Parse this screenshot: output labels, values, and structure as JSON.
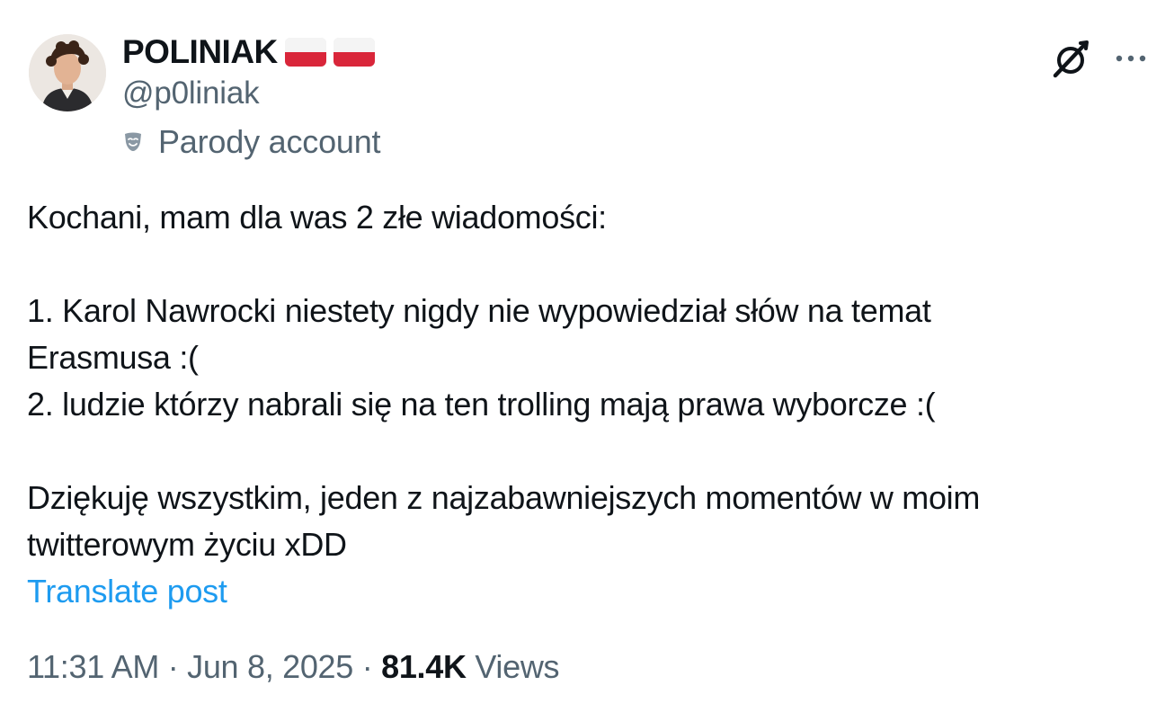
{
  "author": {
    "display_name": "POLINIAK",
    "handle": "@p0liniak",
    "flags": [
      "poland-flag",
      "poland-flag"
    ],
    "label": "Parody account",
    "label_icon": "theater-mask-icon"
  },
  "actions": {
    "grok_icon": "grok-icon",
    "more_icon": "more-dots-icon"
  },
  "post": {
    "lines": [
      "Kochani, mam dla was 2 złe wiadomości:",
      "",
      "1. Karol Nawrocki niestety nigdy nie wypowiedział słów na temat",
      "Erasmusa :(",
      "2. ludzie którzy nabrali się na ten trolling mają prawa wyborcze :(",
      "",
      "Dziękuję wszystkim, jeden z najzabawniejszych momentów w moim",
      "twitterowym życiu xDD"
    ],
    "translate_label": "Translate post"
  },
  "meta": {
    "time": "11:31 AM",
    "separator": " · ",
    "date": "Jun 8, 2025",
    "views_count": "81.4K",
    "views_label": "Views"
  },
  "colors": {
    "text": "#0f1419",
    "secondary": "#536471",
    "link": "#1d9bf0",
    "flag_red": "#d9263a"
  }
}
